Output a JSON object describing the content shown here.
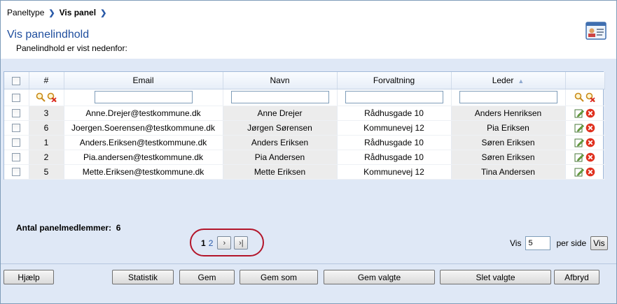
{
  "breadcrumb": {
    "items": [
      "Paneltype",
      "Vis panel"
    ]
  },
  "header": {
    "title": "Vis panelindhold",
    "subtitle": "Panelindhold er vist nedenfor:",
    "icon": "contact-card-icon"
  },
  "grid": {
    "columns": [
      "#",
      "Email",
      "Navn",
      "Forvaltning",
      "Leder"
    ],
    "sorted_column": "Leder",
    "sort_direction": "ascending",
    "rows": [
      {
        "id": "3",
        "email": "Anne.Drejer@testkommune.dk",
        "name": "Anne Drejer",
        "dept": "Rådhusgade 10",
        "leader": "Anders Henriksen"
      },
      {
        "id": "6",
        "email": "Joergen.Soerensen@testkommune.dk",
        "name": "Jørgen Sørensen",
        "dept": "Kommunevej 12",
        "leader": "Pia Eriksen"
      },
      {
        "id": "1",
        "email": "Anders.Eriksen@testkommune.dk",
        "name": "Anders Eriksen",
        "dept": "Rådhusgade 10",
        "leader": "Søren Eriksen"
      },
      {
        "id": "2",
        "email": "Pia.andersen@testkommune.dk",
        "name": "Pia Andersen",
        "dept": "Rådhusgade 10",
        "leader": "Søren Eriksen"
      },
      {
        "id": "5",
        "email": "Mette.Eriksen@testkommune.dk",
        "name": "Mette Eriksen",
        "dept": "Kommunevej 12",
        "leader": "Tina Andersen"
      }
    ]
  },
  "summary": {
    "members_label": "Antal panelmedlemmer:",
    "members_count": "6"
  },
  "pager": {
    "current": "1",
    "next_page": "2"
  },
  "per_page": {
    "label": "Vis",
    "value": "5",
    "suffix": "per side",
    "button": "Vis"
  },
  "buttons": {
    "help": "Hjælp",
    "statistics": "Statistik",
    "save": "Gem",
    "save_as": "Gem som",
    "save_selected": "Gem valgte",
    "delete_selected": "Slet valgte",
    "cancel": "Afbryd"
  },
  "colors": {
    "accent": "#1f4e9e",
    "highlight_ring": "#b3152a",
    "background": "#dfe8f6"
  }
}
